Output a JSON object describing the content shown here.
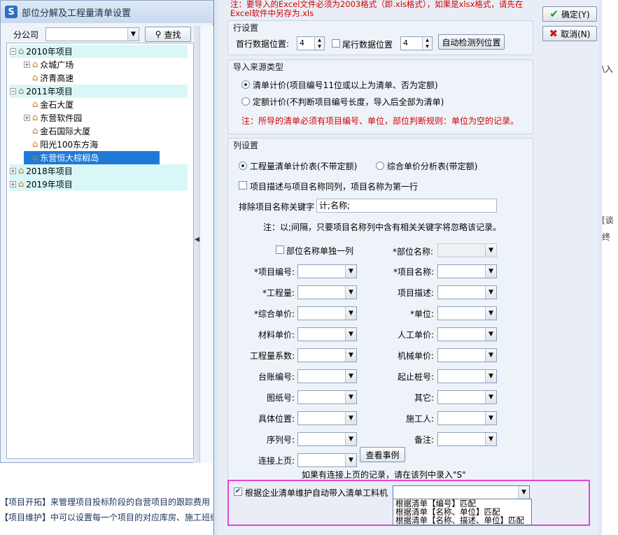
{
  "main_window": {
    "title": "部位分解及工程量清单设置",
    "company_label": "分公司",
    "find_button": "查找",
    "tree": [
      {
        "label": "2010年项目",
        "type": "group",
        "expander": "−"
      },
      {
        "label": "众城广场",
        "type": "item",
        "expander": "+"
      },
      {
        "label": "济青高速",
        "type": "item",
        "expander": ""
      },
      {
        "label": "2011年项目",
        "type": "group",
        "expander": "−"
      },
      {
        "label": "金石大厦",
        "type": "item",
        "expander": ""
      },
      {
        "label": "东营软件园",
        "type": "item",
        "expander": "+"
      },
      {
        "label": "金石国际大厦",
        "type": "item",
        "expander": ""
      },
      {
        "label": "阳光100东方海",
        "type": "item",
        "expander": ""
      },
      {
        "label": "东营恒大棕榈岛",
        "type": "selected",
        "expander": ""
      },
      {
        "label": "2018年项目",
        "type": "group",
        "expander": "+"
      },
      {
        "label": "2019年项目",
        "type": "group",
        "expander": "+"
      }
    ],
    "bottom_lines": [
      "【项目开拓】来管理项目投标阶段的自营项目的跟踪费用",
      "【项目维护】中可以设置每一个项目的对应库房、施工班组、部位及进度计划、材料采购流程、项目材料计"
    ],
    "right_fragments": [
      "\\入",
      "[谈",
      "终"
    ]
  },
  "dialog": {
    "notice": "注：要导入的Excel文件必须为2003格式（即.xls格式），如果是xlsx格式，请先在Excel软件中另存为.xls",
    "ok_button": "确定(Y)",
    "cancel_button": "取消(N)",
    "row_settings": {
      "title": "行设置",
      "first_row_label": "首行数据位置:",
      "first_row_value": "4",
      "last_row_label": "尾行数据位置",
      "last_row_value": "4",
      "auto_detect_button": "自动检测列位置"
    },
    "import_source": {
      "title": "导入来源类型",
      "option_list": "清单计价(项目编号11位或以上为清单、否为定额)",
      "option_quota": "定额计价(不判断项目编号长度，导入后全部为清单)",
      "note": "注：所导的清单必须有项目编号、单位，部位判断规则：单位为空的记录。"
    },
    "column_settings": {
      "title": "列设置",
      "radio_bill": "工程量清单计价表(不带定额)",
      "radio_analysis": "综合单价分析表(带定额)",
      "merge_desc_label": "项目描述与项目名称同列，项目名称为第一行",
      "exclude_label": "排除项目名称关键字",
      "exclude_value": "计;名称;",
      "exclude_note": "注：以;间隔，只要项目名称列中含有相关关键字将忽略该记录。",
      "part_separate_label": "部位名称单独一列",
      "part_name_label": "*部位名称:",
      "left_fields": [
        "*项目编号:",
        "*工程量:",
        "*综合单价:",
        "材料单价:",
        "工程量系数:",
        "台账编号:",
        "图纸号:",
        "具体位置:",
        "序列号:",
        "连接上页:"
      ],
      "right_fields": [
        "*项目名称:",
        "项目描述:",
        "*单位:",
        "人工单价:",
        "机械单价:",
        "起止桩号:",
        "其它:",
        "施工人:",
        "备注:"
      ],
      "view_example_button": "查看事例",
      "connect_note": "如果有连接上页的记录，请在该列中录入\"S\""
    },
    "auto_bring": {
      "label": "根据企业清单维护自动带入清单工料机",
      "options": [
        "根据清单【编号】匹配",
        "根据清单【名称、单位】匹配",
        "根据清单【名称、描述、单位】匹配"
      ]
    }
  }
}
